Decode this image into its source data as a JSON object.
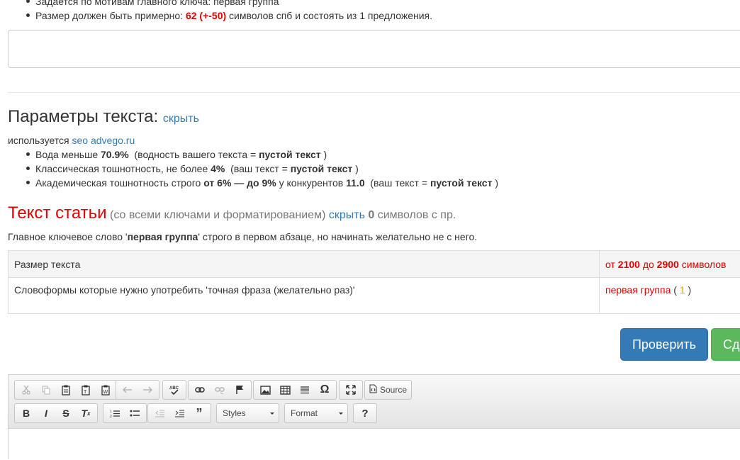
{
  "top_list": {
    "item1": "Задается по мотивам главного ключа: первая группа",
    "item2_prefix": "Размер должен быть примерно: ",
    "item2_value": "62 (+-50)",
    "item2_suffix": " символов спб и состоять из 1 предложения."
  },
  "params": {
    "heading": "Параметры текста: ",
    "hide_link": "скрыть",
    "used_prefix": "используется ",
    "used_link": "seo advego.ru",
    "items": [
      {
        "a": "Вода меньше ",
        "b": "70.9%",
        "c": "  (водность вашего текста = ",
        "d": "пустой текст",
        "e": " )"
      },
      {
        "a": "Классическая тошнотность, не более ",
        "b": "4%",
        "c": "  (ваш текст = ",
        "d": "пустой текст",
        "e": " )"
      },
      {
        "a": "Академическая тошнотность строго ",
        "b": "от 6% — до 9%",
        "c": " у конкурентов ",
        "d": "11.0",
        "e": "  (ваш текст = ",
        "f": "пустой текст",
        "g": " )"
      }
    ]
  },
  "article": {
    "heading": "Текст статьи",
    "sub": " (со всеми ключами и форматированием) ",
    "hide_link": "скрыть",
    "count": " 0",
    "count_suffix": " символов с пр.",
    "keyword_prefix": "Главное ключевое слово '",
    "keyword": "первая группа",
    "keyword_suffix": "' строго в первом абзаце, но начинать желательно не с него."
  },
  "table": {
    "row1_label": "Размер текста",
    "row1_from": "от ",
    "row1_min": "2100",
    "row1_to": " до ",
    "row1_max": "2900",
    "row1_unit": " символов",
    "row2_label": "Словоформы которые нужно употребить 'точная фраза (желательно раз)'",
    "row2_word": "первая группа",
    "row2_open": " ( ",
    "row2_count": "1",
    "row2_close": " )"
  },
  "buttons": {
    "check": "Проверить",
    "submit": "Сд"
  },
  "editor": {
    "source_label": "Source",
    "styles_label": "Styles",
    "format_label": "Format",
    "help_label": "?"
  },
  "colors": {
    "red": "#e00000",
    "link": "#337ab7",
    "primary_button": "#337ab7",
    "success_button": "#5cb85c"
  }
}
